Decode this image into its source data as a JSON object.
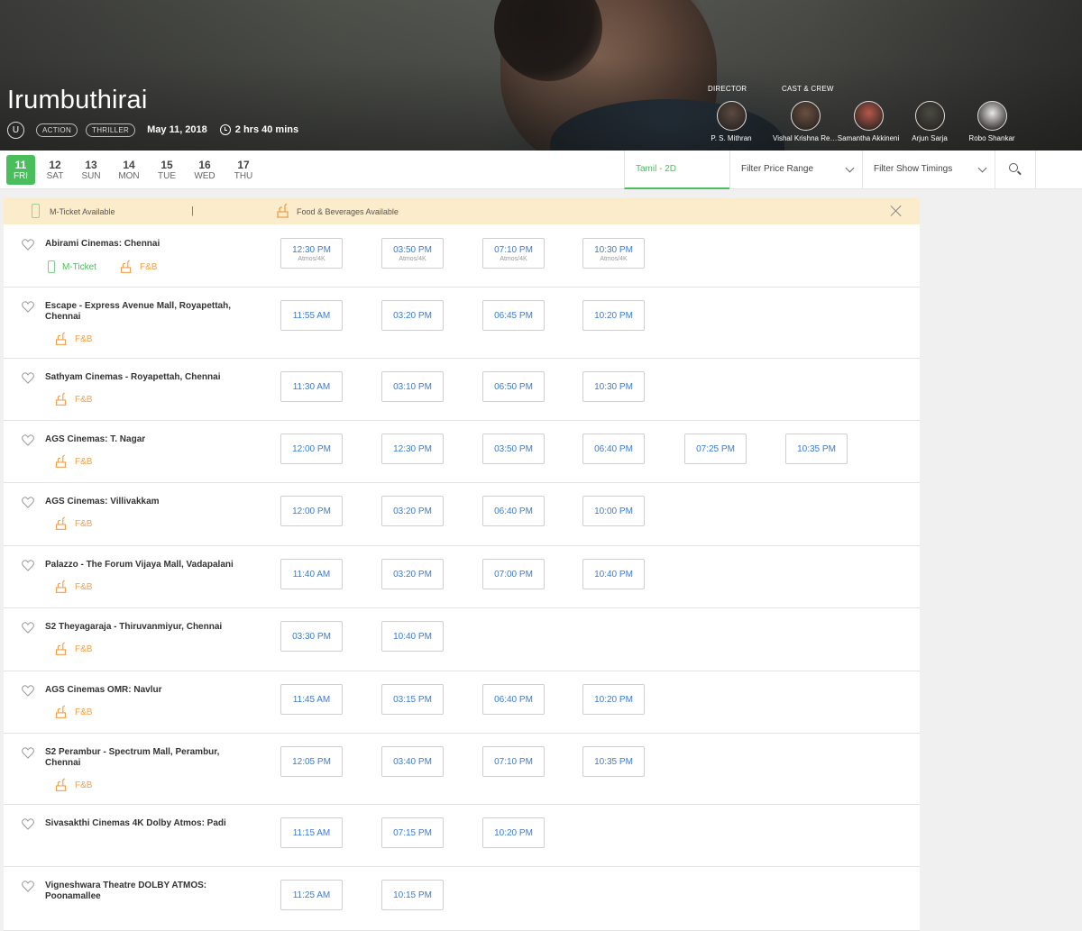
{
  "movie": {
    "title": "Irumbuthirai",
    "certificate": "U",
    "genres": [
      "ACTION",
      "THRILLER"
    ],
    "release_date": "May 11, 2018",
    "runtime": "2 hrs 40 mins"
  },
  "credits": {
    "director_heading": "DIRECTOR",
    "cast_heading": "CAST & CREW",
    "people": [
      {
        "name": "P. S. Mithran",
        "role": "director",
        "color": "#5b4a42"
      },
      {
        "name": "Vishal Krishna Reddy",
        "role": "cast",
        "color": "#6a5040"
      },
      {
        "name": "Samantha Akkineni",
        "role": "cast",
        "color": "#b7584a"
      },
      {
        "name": "Arjun Sarja",
        "role": "cast",
        "color": "#4a4a44"
      },
      {
        "name": "Robo Shankar",
        "role": "cast",
        "color": "#e8e8e8"
      }
    ]
  },
  "dates": [
    {
      "num": "11",
      "day": "FRI",
      "active": true
    },
    {
      "num": "12",
      "day": "SAT"
    },
    {
      "num": "13",
      "day": "SUN"
    },
    {
      "num": "14",
      "day": "MON"
    },
    {
      "num": "15",
      "day": "TUE"
    },
    {
      "num": "16",
      "day": "WED"
    },
    {
      "num": "17",
      "day": "THU"
    }
  ],
  "filters": {
    "language_tab": "Tamil - 2D",
    "price_range": "Filter Price Range",
    "show_timings": "Filter Show Timings"
  },
  "notice": {
    "m_ticket": "M-Ticket Available",
    "separator": "|",
    "food": "Food & Beverages Available"
  },
  "labels": {
    "m_ticket": "M-Ticket",
    "fnb": "F&B"
  },
  "cinemas": [
    {
      "name": "Abirami Cinemas: Chennai",
      "mticket": true,
      "fnb": true,
      "shows": [
        {
          "time": "12:30 PM",
          "format": "Atmos/4K"
        },
        {
          "time": "03:50 PM",
          "format": "Atmos/4K"
        },
        {
          "time": "07:10 PM",
          "format": "Atmos/4K"
        },
        {
          "time": "10:30 PM",
          "format": "Atmos/4K"
        }
      ]
    },
    {
      "name": "Escape - Express Avenue Mall, Royapettah, Chennai",
      "fnb": true,
      "shows": [
        {
          "time": "11:55 AM"
        },
        {
          "time": "03:20 PM"
        },
        {
          "time": "06:45 PM"
        },
        {
          "time": "10:20 PM"
        }
      ]
    },
    {
      "name": "Sathyam Cinemas - Royapettah, Chennai",
      "fnb": true,
      "shows": [
        {
          "time": "11:30 AM"
        },
        {
          "time": "03:10 PM"
        },
        {
          "time": "06:50 PM"
        },
        {
          "time": "10:30 PM"
        }
      ]
    },
    {
      "name": "AGS Cinemas: T. Nagar",
      "fnb": true,
      "shows": [
        {
          "time": "12:00 PM"
        },
        {
          "time": "12:30 PM"
        },
        {
          "time": "03:50 PM"
        },
        {
          "time": "06:40 PM"
        },
        {
          "time": "07:25 PM"
        },
        {
          "time": "10:35 PM"
        }
      ]
    },
    {
      "name": "AGS Cinemas: Villivakkam",
      "fnb": true,
      "shows": [
        {
          "time": "12:00 PM"
        },
        {
          "time": "03:20 PM"
        },
        {
          "time": "06:40 PM"
        },
        {
          "time": "10:00 PM"
        }
      ]
    },
    {
      "name": "Palazzo - The Forum Vijaya Mall, Vadapalani",
      "fnb": true,
      "shows": [
        {
          "time": "11:40 AM"
        },
        {
          "time": "03:20 PM"
        },
        {
          "time": "07:00 PM"
        },
        {
          "time": "10:40 PM"
        }
      ]
    },
    {
      "name": "S2 Theyagaraja - Thiruvanmiyur, Chennai",
      "fnb": true,
      "shows": [
        {
          "time": "03:30 PM"
        },
        {
          "time": "10:40 PM"
        }
      ]
    },
    {
      "name": "AGS Cinemas OMR: Navlur",
      "fnb": true,
      "shows": [
        {
          "time": "11:45 AM"
        },
        {
          "time": "03:15 PM"
        },
        {
          "time": "06:40 PM"
        },
        {
          "time": "10:20 PM"
        }
      ]
    },
    {
      "name": "S2 Perambur - Spectrum Mall, Perambur, Chennai",
      "fnb": true,
      "shows": [
        {
          "time": "12:05 PM"
        },
        {
          "time": "03:40 PM"
        },
        {
          "time": "07:10 PM"
        },
        {
          "time": "10:35 PM"
        }
      ]
    },
    {
      "name": "Sivasakthi Cinemas 4K Dolby Atmos: Padi",
      "shows": [
        {
          "time": "11:15 AM"
        },
        {
          "time": "07:15 PM"
        },
        {
          "time": "10:20 PM"
        }
      ]
    },
    {
      "name": "Vigneshwara Theatre DOLBY ATMOS: Poonamallee",
      "shows": [
        {
          "time": "11:25 AM"
        },
        {
          "time": "10:15 PM"
        }
      ]
    }
  ],
  "colors": {
    "accent_green": "#4abd5d",
    "showtime_blue": "#3a7bd5",
    "fnb_orange": "#f0a04b",
    "notice_bg": "#fbeccb"
  }
}
